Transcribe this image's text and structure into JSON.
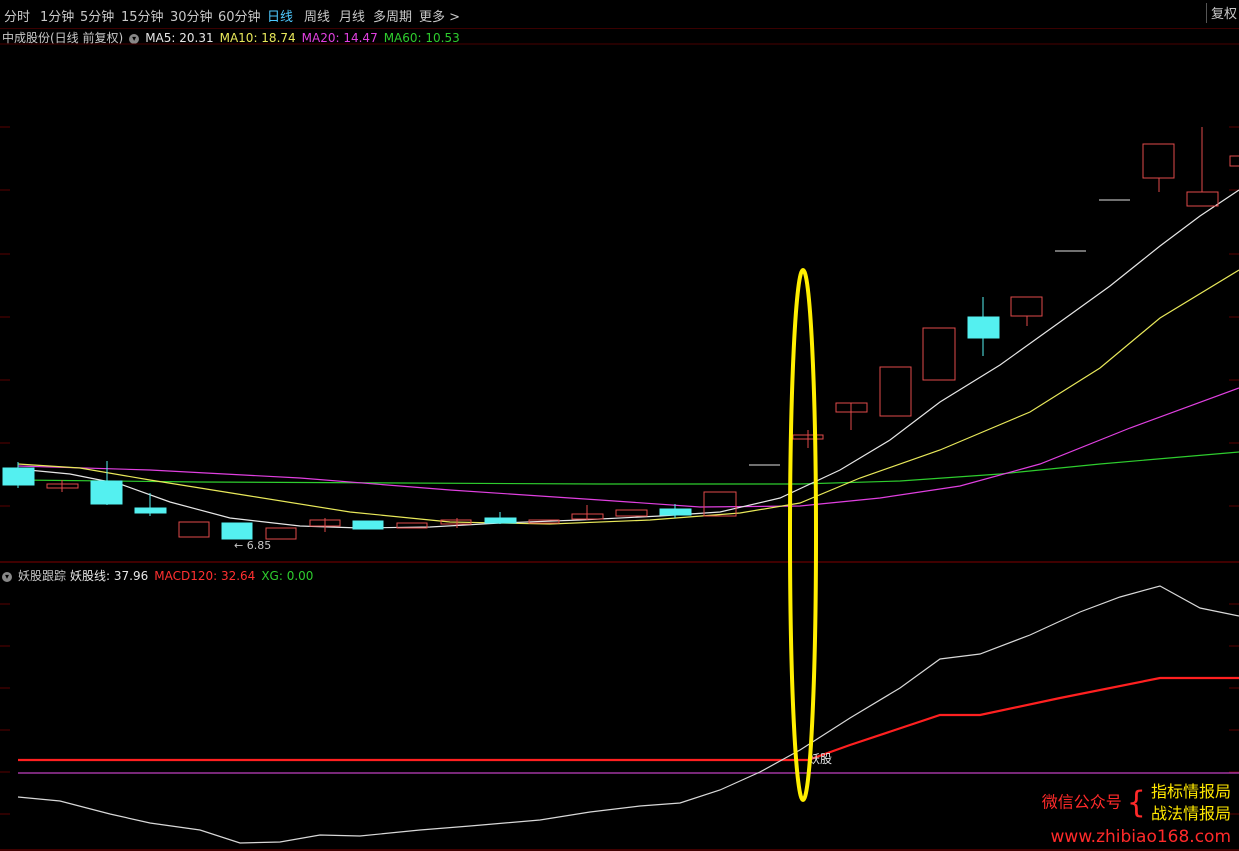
{
  "toolbar": {
    "periods": [
      "分时",
      "1分钟",
      "5分钟",
      "15分钟",
      "30分钟",
      "60分钟",
      "日线",
      "周线",
      "月线",
      "多周期",
      "更多"
    ],
    "active": "日线",
    "fuquan": "复权"
  },
  "main_panel": {
    "stock_title": "中成股份(日线 前复权)",
    "ma5": "MA5: 20.31",
    "ma10": "MA10: 18.74",
    "ma20": "MA20: 14.47",
    "ma60": "MA60: 10.53",
    "low_marker": "6.85",
    "colors": {
      "ma5": "#e6e6e6",
      "ma10": "#e8e85a",
      "ma20": "#e040e0",
      "ma60": "#2ecc2e",
      "up": "#e04a4a",
      "down": "#54f0f0"
    }
  },
  "indicator_panel": {
    "name": "妖股跟踪",
    "yaogu_line": "妖股线: 37.96",
    "macd120": "MACD120: 32.64",
    "xg": "XG: 0.00",
    "signal_label": "妖股"
  },
  "watermark": {
    "line1": "微信公众号",
    "right1": "指标情报局",
    "right2": "战法情报局",
    "url": "www.zhibiao168.com"
  }
}
